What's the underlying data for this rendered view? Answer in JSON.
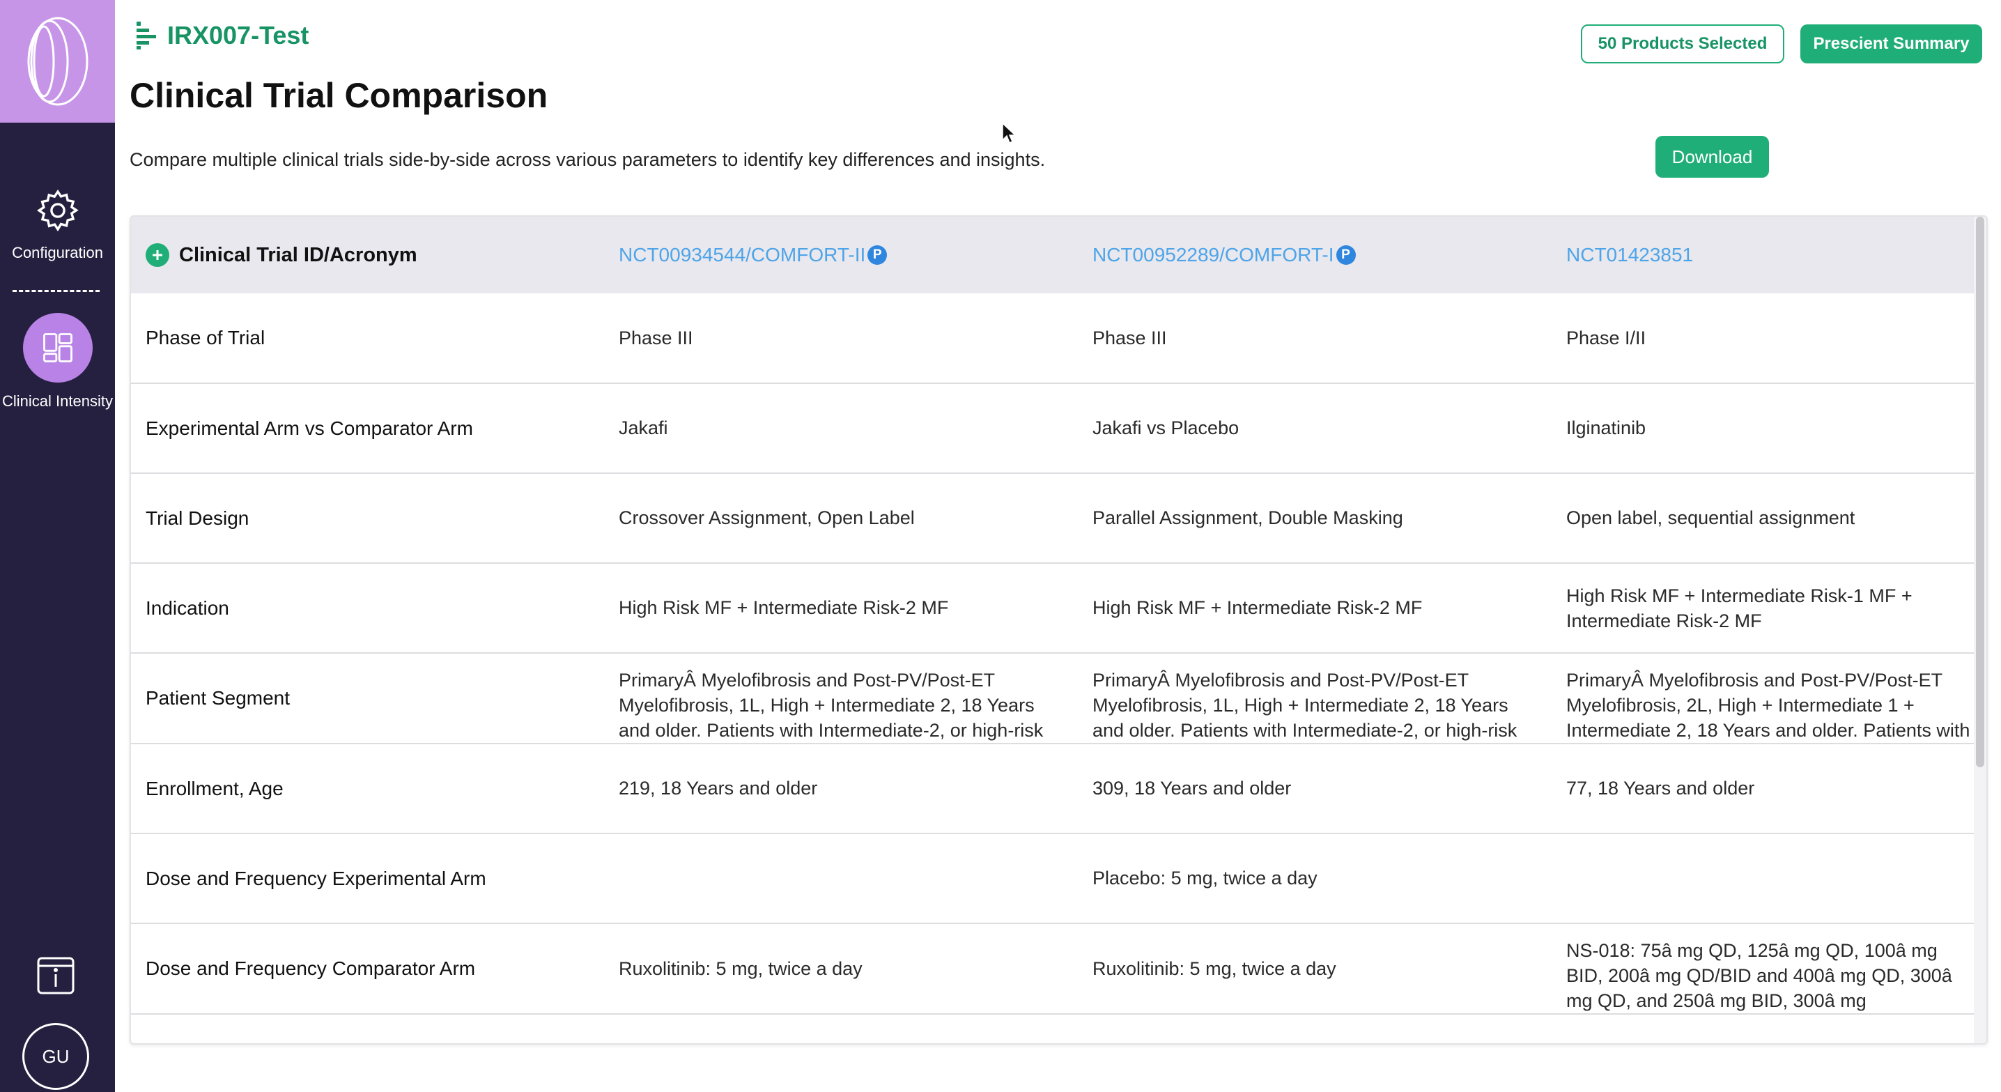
{
  "sidebar": {
    "items": [
      {
        "label": "Configuration",
        "icon": "gear-icon"
      },
      {
        "label": "Clinical Intensity",
        "icon": "dashboard-icon"
      }
    ],
    "avatar_initials": "GU",
    "colors": {
      "bg": "#262040",
      "logo_bg": "#c795e8",
      "active": "#b982e6"
    }
  },
  "header": {
    "project_name": "IRX007-Test",
    "title": "Clinical Trial Comparison",
    "subtitle": "Compare multiple clinical trials side-by-side across various parameters to identify key differences and insights.",
    "products_selected_label": "50 Products Selected",
    "summary_label": "Prescient Summary",
    "download_label": "Download",
    "accent_color": "#1fae77"
  },
  "table": {
    "header": {
      "label": "Clinical Trial ID/Acronym",
      "trials": [
        {
          "id": "NCT00934544/COMFORT-II",
          "badge": "P"
        },
        {
          "id": "NCT00952289/COMFORT-I",
          "badge": "P"
        },
        {
          "id": "NCT01423851",
          "badge": ""
        }
      ]
    },
    "rows": [
      {
        "label": "Phase of Trial",
        "values": [
          "Phase III",
          "Phase III",
          "Phase I/II"
        ]
      },
      {
        "label": "Experimental Arm vs Comparator Arm",
        "values": [
          "Jakafi",
          "Jakafi vs Placebo",
          "Ilginatinib"
        ]
      },
      {
        "label": "Trial Design",
        "values": [
          "Crossover Assignment, Open Label",
          "Parallel Assignment, Double Masking",
          "Open label, sequential assignment"
        ]
      },
      {
        "label": "Indication",
        "values": [
          "High Risk MF + Intermediate Risk-2 MF",
          "High Risk MF + Intermediate Risk-2 MF",
          "High Risk MF + Intermediate Risk-1 MF + Intermediate Risk-2 MF"
        ]
      },
      {
        "label": "Patient Segment",
        "values": [
          "PrimaryÂ Myelofibrosis and Post-PV/Post-ET Myelofibrosis, 1L, High + Intermediate 2, 18 Years and older. Patients with Intermediate-2, or high-risk",
          "PrimaryÂ Myelofibrosis and Post-PV/Post-ET Myelofibrosis, 1L, High + Intermediate 2, 18 Years and older. Patients with Intermediate-2, or high-risk",
          "PrimaryÂ Myelofibrosis and Post-PV/Post-ET Myelofibrosis, 2L, High + Intermediate 1 + Intermediate 2, 18 Years and older. Patients with"
        ]
      },
      {
        "label": "Enrollment, Age",
        "values": [
          "219, 18 Years and older",
          "309, 18 Years and older",
          "77, 18 Years and older"
        ]
      },
      {
        "label": "Dose and Frequency Experimental Arm",
        "values": [
          "",
          "Placebo: 5 mg, twice a day",
          ""
        ]
      },
      {
        "label": "Dose and Frequency Comparator Arm",
        "values": [
          "Ruxolitinib: 5 mg, twice a day",
          "Ruxolitinib: 5 mg, twice a day",
          "NS-018: 75â mg QD, 125â mg QD, 100â mg BID, 200â mg QD/BID and 400â mg QD, 300â mg QD, and 250â mg BID, 300â mg"
        ]
      }
    ]
  }
}
